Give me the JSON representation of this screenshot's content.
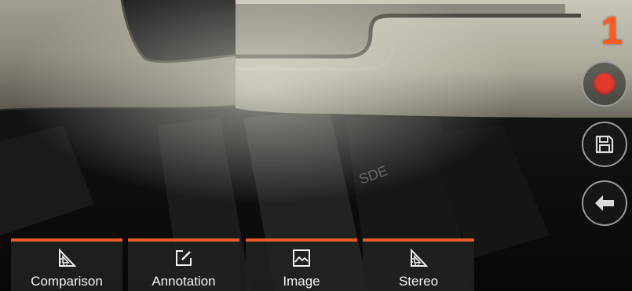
{
  "step_number": "1",
  "side_buttons": [
    {
      "name": "record",
      "icon": "record-icon"
    },
    {
      "name": "save",
      "icon": "save-icon"
    },
    {
      "name": "back",
      "icon": "back-arrow-icon"
    }
  ],
  "toolbar": {
    "buttons": [
      {
        "label": "Comparison",
        "icon": "triangle-ruler-icon"
      },
      {
        "label": "Annotation",
        "icon": "edit-note-icon"
      },
      {
        "label": "Image",
        "icon": "image-icon"
      },
      {
        "label": "Stereo",
        "icon": "triangle-ruler-icon"
      }
    ]
  },
  "colors": {
    "accent": "#e85a2a",
    "step_number": "#ff5a1f",
    "record": "#e03a30",
    "button_border": "#9a9a9a"
  }
}
